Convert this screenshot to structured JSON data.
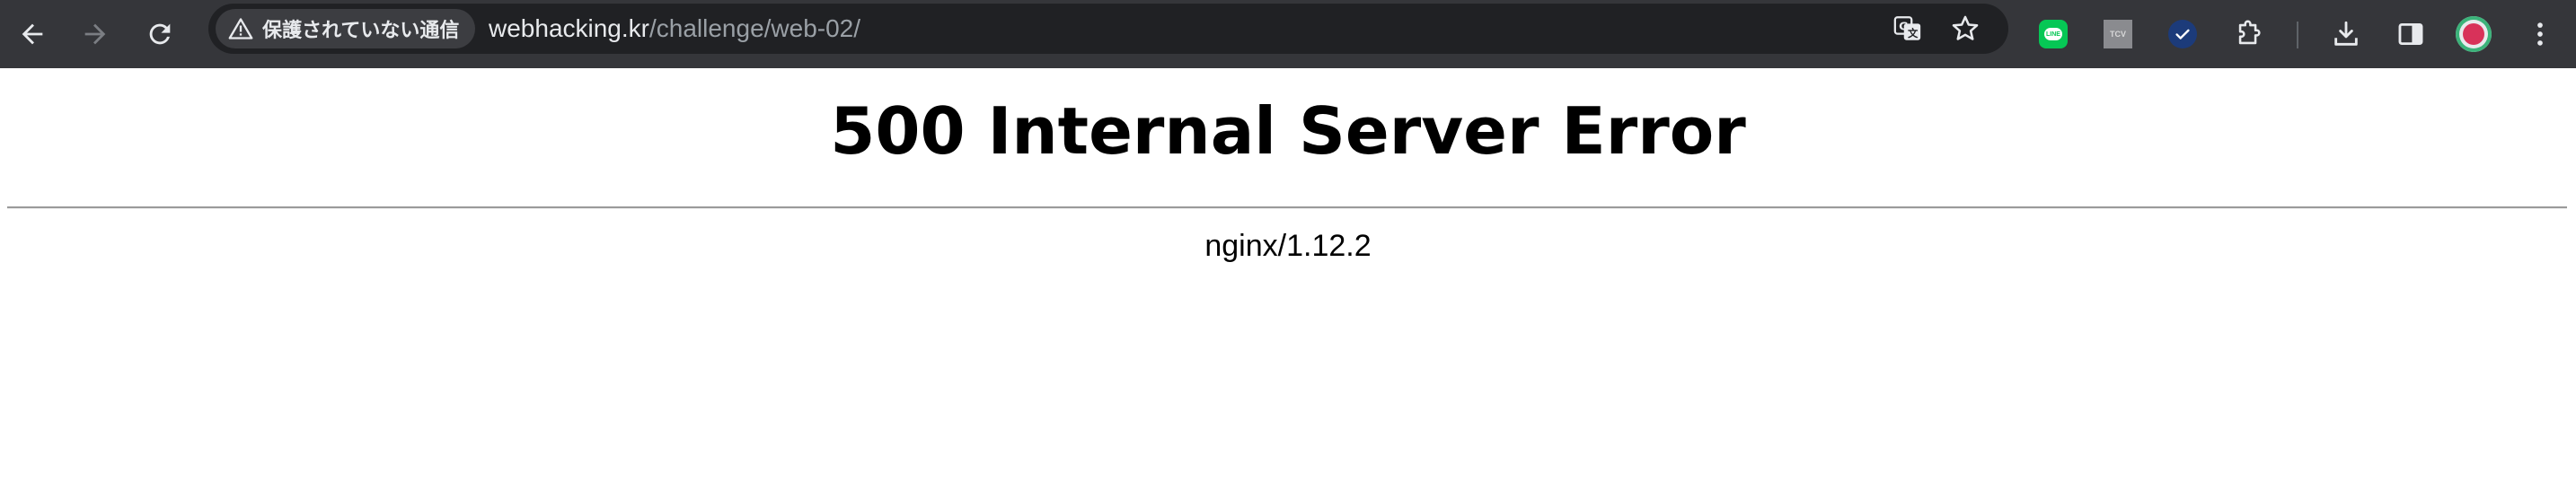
{
  "browser": {
    "nav": {
      "back_icon": "arrow-left-icon",
      "forward_icon": "arrow-right-icon",
      "reload_icon": "reload-icon"
    },
    "address_bar": {
      "security_label": "保護されていない通信",
      "security_icon": "warning-triangle-icon",
      "url_host": "webhacking.kr",
      "url_path": "/challenge/web-02/",
      "translate_icon": "translate-icon",
      "bookmark_icon": "star-icon"
    },
    "extensions": [
      {
        "name": "line",
        "icon": "line-extension-icon",
        "label": "LINE"
      },
      {
        "name": "tcv",
        "icon": "tcv-extension-icon",
        "label": "TCV"
      },
      {
        "name": "bitwarden",
        "icon": "check-shield-extension-icon"
      },
      {
        "name": "extensions",
        "icon": "puzzle-icon"
      }
    ],
    "right_actions": {
      "downloads_icon": "download-icon",
      "side_panel_icon": "side-panel-icon",
      "profile_icon": "profile-avatar",
      "menu_icon": "kebab-menu-icon"
    },
    "colors": {
      "toolbar_bg": "#35363a",
      "omnibox_bg": "#202124",
      "text": "#e8eaed",
      "muted_text": "#9aa0a6"
    }
  },
  "page": {
    "title": "500 Internal Server Error",
    "server_signature": "nginx/1.12.2"
  }
}
